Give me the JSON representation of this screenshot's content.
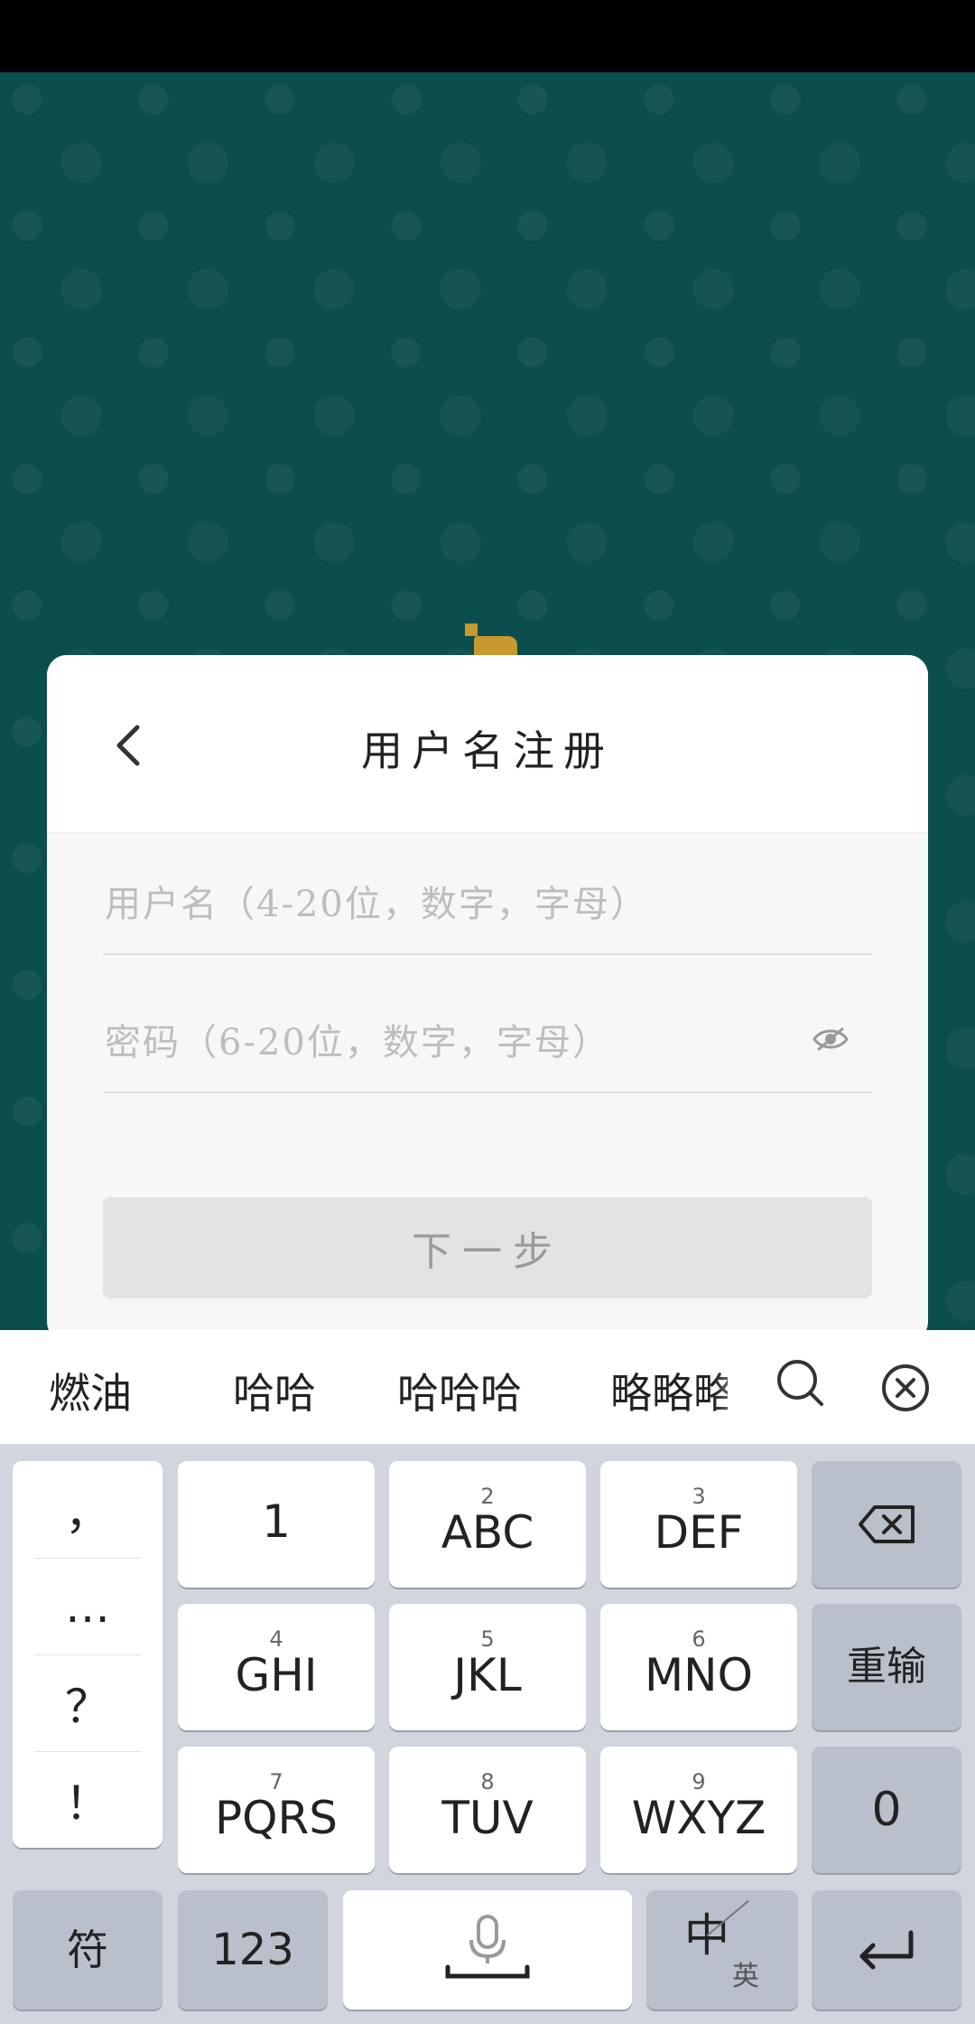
{
  "card": {
    "title": "用户名注册",
    "username_placeholder": "用户名（4-20位，数字，字母）",
    "password_placeholder": "密码（6-20位，数字，字母）",
    "next_label": "下一步"
  },
  "candidates": [
    "燃油",
    "哈哈",
    "哈哈哈",
    "略略略"
  ],
  "keyboard": {
    "punct": [
      "，",
      "…",
      "？",
      "！"
    ],
    "keys": {
      "k1": {
        "num": "",
        "main": "1"
      },
      "k2": {
        "num": "2",
        "main": "ABC"
      },
      "k3": {
        "num": "3",
        "main": "DEF"
      },
      "k4": {
        "num": "4",
        "main": "GHI"
      },
      "k5": {
        "num": "5",
        "main": "JKL"
      },
      "k6": {
        "num": "6",
        "main": "MNO"
      },
      "k7": {
        "num": "7",
        "main": "PQRS"
      },
      "k8": {
        "num": "8",
        "main": "TUV"
      },
      "k9": {
        "num": "9",
        "main": "WXYZ"
      }
    },
    "reinput": "重输",
    "zero": "0",
    "symbols": "符",
    "numbers": "123",
    "lang_zh": "中",
    "lang_en": "英"
  },
  "icons": [
    "back-arrow-icon",
    "eye-icon",
    "search-icon",
    "close-circle-icon",
    "backspace-icon",
    "microphone-icon",
    "enter-icon"
  ],
  "colors": {
    "background": "#0c4d4d",
    "keyboard": "#d1d5dd",
    "mascot": "#c79a2d"
  }
}
